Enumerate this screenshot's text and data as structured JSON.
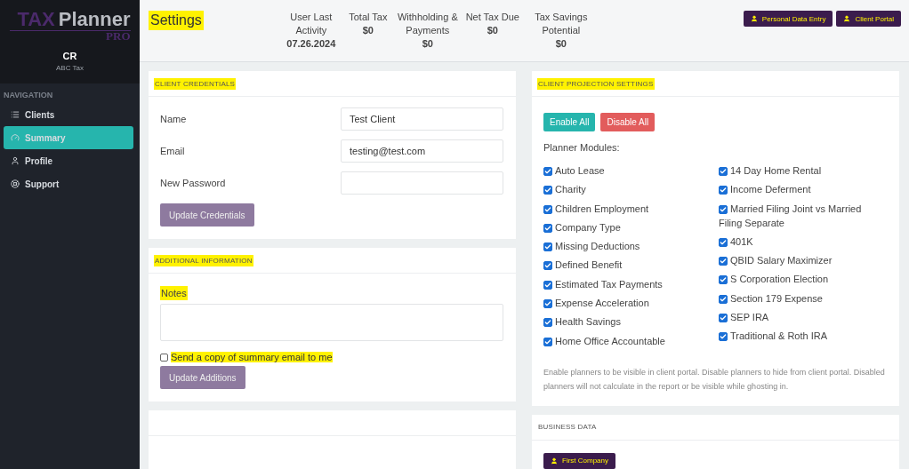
{
  "sidebar": {
    "logo": {
      "mark": "TAX",
      "word": "Planner",
      "sub": "PRO"
    },
    "user_initials": "CR",
    "company": "ABC Tax",
    "section_title": "NAVIGATION",
    "items": [
      {
        "label": "Clients",
        "selected": false
      },
      {
        "label": "Summary",
        "selected": true
      },
      {
        "label": "Profile",
        "selected": false
      },
      {
        "label": "Support",
        "selected": false
      }
    ]
  },
  "header": {
    "title": "Settings",
    "title_highlighted": true,
    "stats": [
      {
        "label": "User Last Activity",
        "value": "07.26.2024"
      },
      {
        "label": "Total Tax",
        "value": "$0"
      },
      {
        "label": "Withholding & Payments",
        "value": "$0"
      },
      {
        "label": "Net Tax Due",
        "value": "$0"
      },
      {
        "label": "Tax Savings Potential",
        "value": "$0"
      }
    ],
    "buttons": [
      {
        "label": "Personal Data Entry",
        "highlighted": true
      },
      {
        "label": "Client Portal",
        "highlighted": true
      }
    ]
  },
  "client_credentials": {
    "title": "CLIENT CREDENTIALS",
    "highlighted": true,
    "fields": [
      {
        "label": "Name",
        "value": "Test Client"
      },
      {
        "label": "Email",
        "value": "testing@test.com"
      },
      {
        "label": "New Password"
      }
    ],
    "button": "Update Credentials"
  },
  "additional_information": {
    "title": "ADDITIONAL INFORMATION",
    "highlighted": true,
    "notes_label": "Notes",
    "notes_highlighted": true,
    "send_copy": {
      "label": "Send a copy of summary email to me",
      "checked": false,
      "highlighted": true
    },
    "button": "Update Additions"
  },
  "client_projection_settings": {
    "title": "CLIENT PROJECTION SETTINGS",
    "highlighted": true,
    "enable_all": "Enable All",
    "disable_all": "Disable All",
    "modules_label": "Planner Modules:",
    "columns": [
      [
        {
          "label": "Auto Lease",
          "checked": true
        },
        {
          "label": "Charity",
          "checked": true
        },
        {
          "label": "Children Employment",
          "checked": true
        },
        {
          "label": "Company Type",
          "checked": true
        },
        {
          "label": "Missing Deductions",
          "checked": true
        },
        {
          "label": "Defined Benefit",
          "checked": true
        },
        {
          "label": "Estimated Tax Payments",
          "checked": true
        },
        {
          "label": "Expense Acceleration",
          "checked": true
        },
        {
          "label": "Health Savings",
          "checked": true
        },
        {
          "label": "Home Office Accountable",
          "checked": true
        }
      ],
      [
        {
          "label": "14 Day Home Rental",
          "checked": true
        },
        {
          "label": "Income Deferment",
          "checked": true
        },
        {
          "label": "Married Filing Joint vs Married Filing Separate",
          "checked": true
        },
        {
          "label": "401K",
          "checked": true
        },
        {
          "label": "QBID Salary Maximizer",
          "checked": true
        },
        {
          "label": "S Corporation Election",
          "checked": true
        },
        {
          "label": "Section 179 Expense",
          "checked": true
        },
        {
          "label": "SEP IRA",
          "checked": true
        },
        {
          "label": "Traditional & Roth IRA",
          "checked": true
        }
      ]
    ],
    "note": "Enable planners to be visible in client portal. Disable planners to hide from client portal. Disabled planners will not calculate in the report or be visible while ghosting in."
  },
  "business_data": {
    "title": "BUSINESS DATA",
    "highlighted": false,
    "companies": [
      {
        "label": "First Company",
        "highlighted": true
      }
    ]
  }
}
